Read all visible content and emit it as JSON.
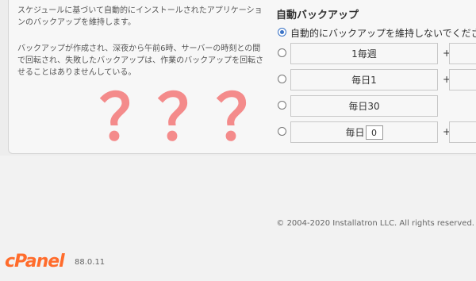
{
  "left": {
    "description_1": "スケジュールに基づいて自動的にインストールされたアプリケーションのバックアップを維持します。",
    "description_2": "バックアップが作成され、深夜から午前6時、サーバーの時刻との間で回転され、失敗したバックアップは、作業のバックアップを回転させることはありませんしている。",
    "question_marks": [
      "？",
      "？",
      "？"
    ]
  },
  "auto_backup": {
    "title": "自動バックアップ",
    "options": [
      {
        "label": "自動的にバックアップを維持しないでくださ",
        "checked": true
      },
      {
        "label": "1毎週",
        "checked": false,
        "extra": "+"
      },
      {
        "label": "毎日1",
        "checked": false,
        "extra": "+"
      },
      {
        "label": "毎日30",
        "checked": false
      },
      {
        "label": "毎日",
        "input_value": "0",
        "checked": false,
        "extra": "+"
      }
    ]
  },
  "footer": {
    "copyright": "© 2004-2020 Installatron LLC. All rights reserved.",
    "logo": "cPanel",
    "version": "88.0.11"
  },
  "colors": {
    "accent": "#3a73c6",
    "question_mark": "#f48b8b",
    "cpanel_orange": "#ff6c2c"
  }
}
